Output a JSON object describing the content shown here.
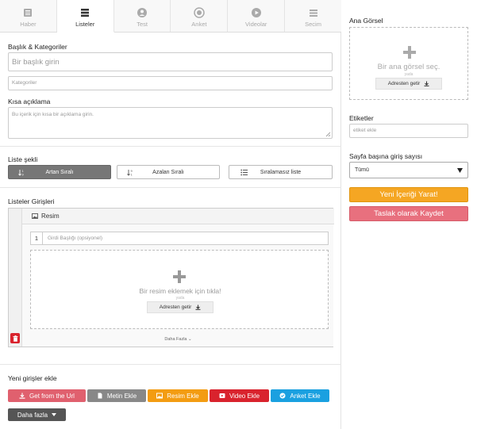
{
  "tabs": [
    {
      "label": "Haber",
      "icon": "newspaper-icon"
    },
    {
      "label": "Listeler",
      "icon": "list-icon"
    },
    {
      "label": "Test",
      "icon": "person-icon"
    },
    {
      "label": "Anket",
      "icon": "target-icon"
    },
    {
      "label": "Videolar",
      "icon": "play-icon"
    },
    {
      "label": "Secim",
      "icon": "menu-icon"
    }
  ],
  "active_tab": "Listeler",
  "form": {
    "title_section": "Başlık & Kategoriler",
    "title_placeholder": "Bir başlık girin",
    "categories_placeholder": "Kategoriler",
    "description_section": "Kısa açıklama",
    "description_placeholder": "Bu içerik için kısa bir açıklama girin.",
    "list_type_section": "Liste şekli",
    "list_types": [
      "Artan Sıralı",
      "Azalan Sıralı",
      "Sıralamasız liste"
    ],
    "selected_list_type": "Artan Sıralı",
    "entries_section": "Listeler Girişleri"
  },
  "entry": {
    "type_label": "Resim",
    "number": "1",
    "title_placeholder": "Girdi Başlığı (opsiyonel)",
    "upload_text": "Bir resim eklemek için tıkla!",
    "or_text": "yada",
    "url_button": "Adresten getir",
    "more_toggle": "Daha Fazla"
  },
  "add_entries": {
    "section": "Yeni girişler ekle",
    "buttons": [
      {
        "label": "Get from the Url",
        "color": "#e0606e",
        "icon": "download-icon"
      },
      {
        "label": "Metin Ekle",
        "color": "#888888",
        "icon": "document-icon"
      },
      {
        "label": "Resim Ekle",
        "color": "#f39c12",
        "icon": "image-icon"
      },
      {
        "label": "Video Ekle",
        "color": "#d9232d",
        "icon": "video-icon"
      },
      {
        "label": "Anket Ekle",
        "color": "#1aa0e0",
        "icon": "check-circle-icon"
      }
    ],
    "more_button": "Daha fazla"
  },
  "sidebar": {
    "main_image_section": "Ana Görsel",
    "main_image_text": "Bir ana görsel seç.",
    "or_text": "yada",
    "url_button": "Adresten getir",
    "tags_section": "Etiketler",
    "tags_placeholder": "etiket ekle",
    "per_page_section": "Sayfa başına giriş sayısı",
    "per_page_value": "Tümü",
    "create_button": "Yeni İçeriği Yarat!",
    "draft_button": "Taslak olarak Kaydet"
  },
  "colors": {
    "create": "#f5a623",
    "draft": "#e8707e",
    "delete": "#d9232d"
  }
}
